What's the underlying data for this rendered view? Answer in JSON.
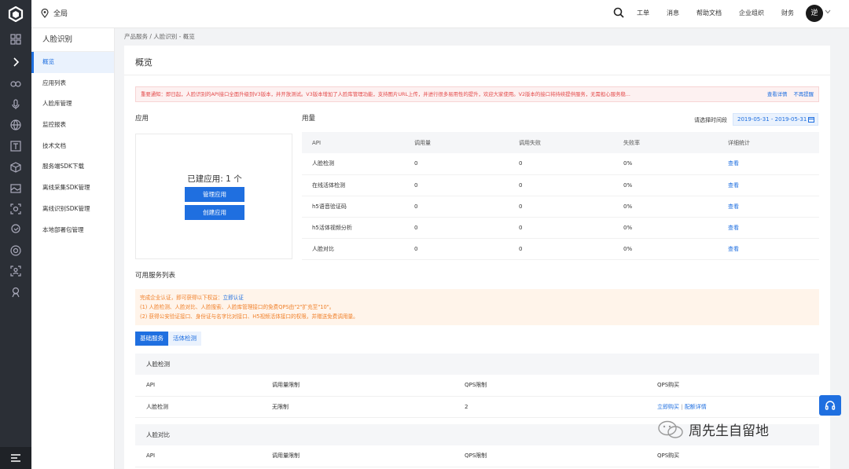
{
  "header": {
    "location": "全局",
    "nav": [
      "工单",
      "消息",
      "帮助文档",
      "企业组织",
      "财务"
    ],
    "avatar_text": "逆"
  },
  "subnav": {
    "title": "人脸识别",
    "items": [
      "概览",
      "应用列表",
      "人脸库管理",
      "监控报表",
      "技术文档",
      "服务端SDK下载",
      "离线采集SDK管理",
      "离线识别SDK管理",
      "本地部署包管理"
    ]
  },
  "breadcrumb": "产品服务 / 人脸识别 - 概览",
  "page_title": "概览",
  "notice": {
    "text": "重要通知：即日起，人脸识别的API接口全面升级到V3版本，并开放测试。V3版本增加了人脸库管理功能，支持图片URL上传，并进行很多易用性的提升，欢迎大家使用。V2版本的接口将持续提供服务，无需担心服务稳...",
    "link_detail": "查看详情",
    "link_dismiss": "不再提醒"
  },
  "apps": {
    "label": "应用",
    "count_text": "已建应用: 1 个",
    "manage_btn": "管理应用",
    "create_btn": "创建应用"
  },
  "usage": {
    "label": "用量",
    "date_label": "请选择时间段",
    "date_range": "2019-05-31 - 2019-05-31",
    "columns": [
      "API",
      "调用量",
      "调用失败",
      "失败率",
      "详细统计"
    ],
    "rows": [
      [
        "人脸检测",
        "0",
        "0",
        "0%",
        "查看"
      ],
      [
        "在线活体检测",
        "0",
        "0",
        "0%",
        "查看"
      ],
      [
        "h5语音验证码",
        "0",
        "0",
        "0%",
        "查看"
      ],
      [
        "h5活体视频分析",
        "0",
        "0",
        "0%",
        "查看"
      ],
      [
        "人脸对比",
        "0",
        "0",
        "0%",
        "查看"
      ]
    ]
  },
  "services": {
    "label": "可用服务列表",
    "cert": {
      "line1_prefix": "完成企业认证，即可获得以下权益：",
      "line1_link": "立即认证",
      "line2": "(1) 人脸检测、人脸对比、人脸搜索、人脸库管理接口的免费QPS由\"2\"扩充至\"10\"。",
      "line3": "(2) 获得公安验证接口、身份证与名字比对接口、H5视频活体接口的权限，并赠送免费调用量。"
    },
    "tabs": [
      "基础服务",
      "活体检测"
    ],
    "blocks": [
      {
        "title": "人脸检测",
        "columns": [
          "API",
          "调用量限制",
          "QPS限制",
          "QPS购买"
        ],
        "row": [
          "人脸检测",
          "无限制",
          "2"
        ],
        "buy_link": "立即购买",
        "config_link": "配额详情"
      },
      {
        "title": "人脸对比",
        "columns": [
          "API",
          "调用量限制",
          "QPS限制",
          "QPS购买"
        ]
      }
    ]
  },
  "watermark": "周先生自留地",
  "colors": {
    "brand": "#1f6fe0",
    "notice_red": "#e34a4a",
    "cert_orange": "#f0802a",
    "rail": "#2b2f36"
  }
}
